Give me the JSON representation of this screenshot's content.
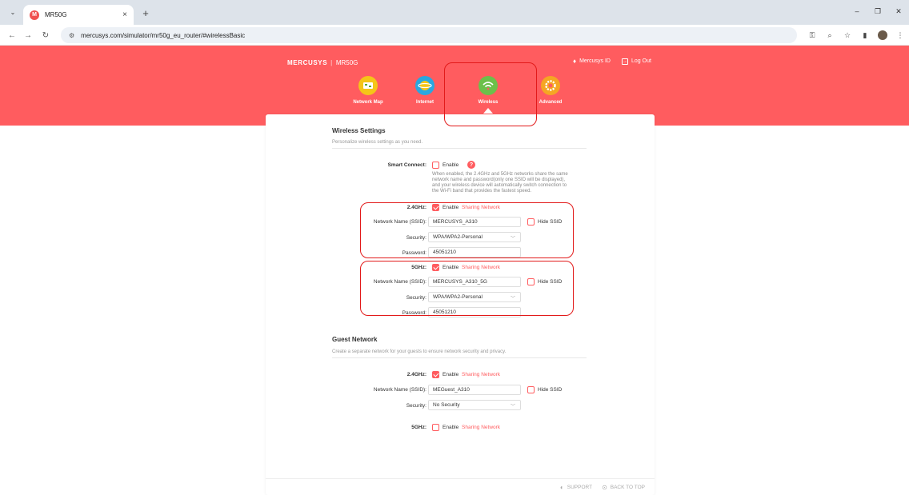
{
  "browser": {
    "tab_title": "MR50G",
    "favicon_letter": "M",
    "url": "mercusys.com/simulator/mr50g_eu_router/#wirelessBasic"
  },
  "header": {
    "brand": "MERCUSYS",
    "separator": "|",
    "model": "MR50G",
    "mercusys_id": "Mercusys ID",
    "logout": "Log Out"
  },
  "nav": {
    "items": [
      {
        "label": "Network Map",
        "icon": "network-map-icon",
        "color": "#f5c518"
      },
      {
        "label": "Internet",
        "icon": "globe-icon",
        "color": "#2aa7df"
      },
      {
        "label": "Wireless",
        "icon": "wifi-icon",
        "color": "#6cc04a"
      },
      {
        "label": "Advanced",
        "icon": "gear-icon",
        "color": "#f5a623"
      }
    ],
    "active": "Wireless"
  },
  "wireless_settings": {
    "title": "Wireless Settings",
    "description": "Personalize wireless settings as you need.",
    "smart_connect": {
      "label": "Smart Connect:",
      "enable_label": "Enable",
      "checked": false,
      "hint_lines": [
        "When enabled, the 2.4GHz and 5GHz networks share the same",
        "network name and password(only one SSID will be displayed),",
        "and your wireless device will automatically switch connection to",
        "the Wi-Fi band that provides the fastest speed."
      ]
    },
    "band_24": {
      "label": "2.4GHz:",
      "enable_label": "Enable",
      "enabled": true,
      "sharing_label": "Sharing Network",
      "ssid_label": "Network Name (SSID):",
      "ssid_value": "MERCUSYS_A310",
      "hide_ssid_label": "Hide SSID",
      "security_label": "Security:",
      "security_value": "WPA/WPA2-Personal",
      "password_label": "Password:",
      "password_value": "45051210"
    },
    "band_5": {
      "label": "5GHz:",
      "enable_label": "Enable",
      "enabled": true,
      "sharing_label": "Sharing Network",
      "ssid_label": "Network Name (SSID):",
      "ssid_value": "MERCUSYS_A310_5G",
      "hide_ssid_label": "Hide SSID",
      "security_label": "Security:",
      "security_value": "WPA/WPA2-Personal",
      "password_label": "Password:",
      "password_value": "45051210"
    }
  },
  "guest_network": {
    "title": "Guest Network",
    "description": "Create a separate network for your guests to ensure network security and privacy.",
    "band_24": {
      "label": "2.4GHz:",
      "enable_label": "Enable",
      "enabled": true,
      "sharing_label": "Sharing Network",
      "ssid_label": "Network Name (SSID):",
      "ssid_value": "MEGuest_A310",
      "hide_ssid_label": "Hide SSID",
      "security_label": "Security:",
      "security_value": "No Security"
    },
    "band_5": {
      "label": "5GHz:",
      "enable_label": "Enable",
      "enabled": false,
      "sharing_label": "Sharing Network"
    }
  },
  "footer": {
    "support": "SUPPORT",
    "back_to_top": "BACK TO TOP"
  },
  "colors": {
    "brand": "#ff5c5f",
    "highlight": "#e21a1a"
  }
}
